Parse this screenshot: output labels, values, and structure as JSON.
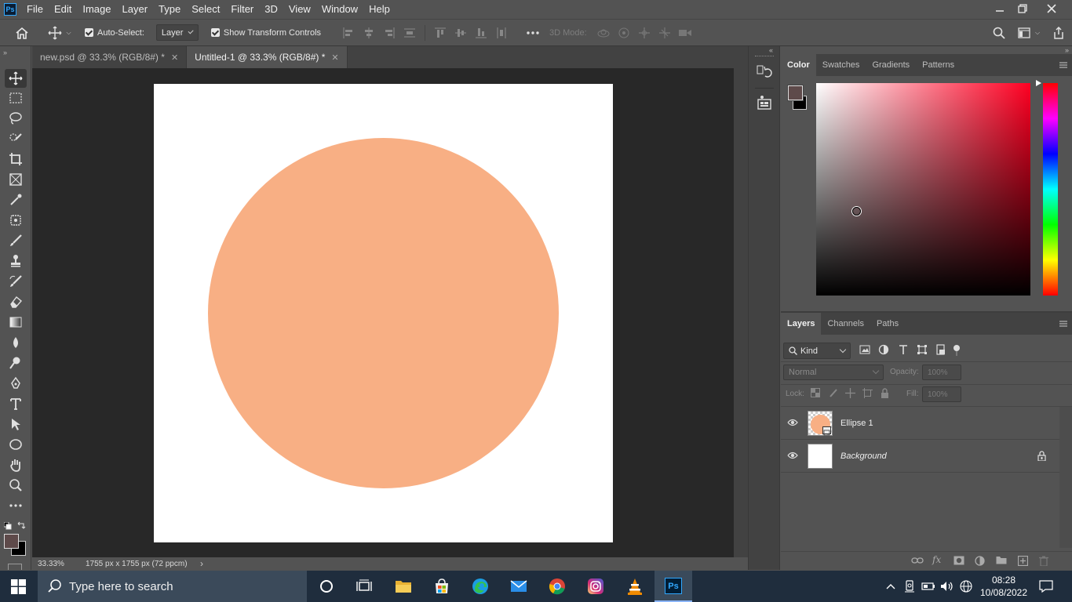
{
  "app": {
    "logo_text": "Ps"
  },
  "menu": [
    "File",
    "Edit",
    "Image",
    "Layer",
    "Type",
    "Select",
    "Filter",
    "3D",
    "View",
    "Window",
    "Help"
  ],
  "options": {
    "auto_select_label": "Auto-Select:",
    "auto_select_value": "Layer",
    "show_transform_label": "Show Transform Controls",
    "mode_3d_label": "3D Mode:"
  },
  "tabs": [
    {
      "label": "new.psd @ 33.3% (RGB/8#) *",
      "active": false
    },
    {
      "label": "Untitled-1 @ 33.3% (RGB/8#) *",
      "active": true
    }
  ],
  "canvas": {
    "ellipse_color": "#f8af84",
    "background_color": "#ffffff"
  },
  "status": {
    "zoom": "33.33%",
    "doc_info": "1755 px x 1755 px (72 ppcm)"
  },
  "color_panel": {
    "tabs": [
      "Color",
      "Swatches",
      "Gradients",
      "Patterns"
    ],
    "foreground_color": "#5e4a4a",
    "background_color": "#000000",
    "hue_color": "#ff0022"
  },
  "layers_panel": {
    "tabs": [
      "Layers",
      "Channels",
      "Paths"
    ],
    "filter_kind": "Kind",
    "blend_mode": "Normal",
    "opacity_label": "Opacity:",
    "opacity_value": "100%",
    "lock_label": "Lock:",
    "fill_label": "Fill:",
    "fill_value": "100%",
    "layers": [
      {
        "name": "Ellipse 1",
        "italic": false,
        "locked": false
      },
      {
        "name": "Background",
        "italic": true,
        "locked": true
      }
    ]
  },
  "taskbar": {
    "search_placeholder": "Type here to search",
    "time": "08:28",
    "date": "10/08/2022"
  }
}
